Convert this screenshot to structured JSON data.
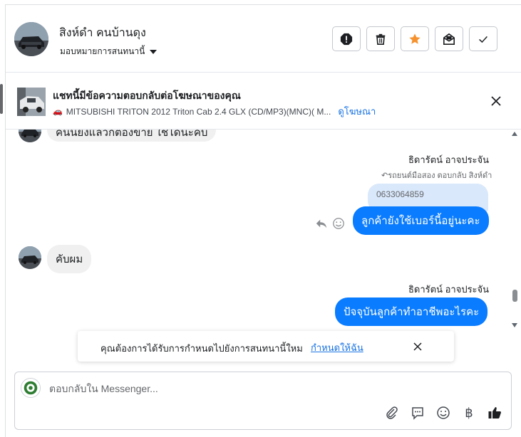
{
  "header": {
    "name": "สิงห์ดำ คนบ้านดุง",
    "assign_label": "มอบหมายการสนทนานี้",
    "actions": [
      {
        "name": "spam-button",
        "icon": "alert-icon"
      },
      {
        "name": "delete-button",
        "icon": "trash-icon"
      },
      {
        "name": "star-button",
        "icon": "star-icon",
        "color": "#f5922f"
      },
      {
        "name": "mark-unread-button",
        "icon": "envelope-icon"
      },
      {
        "name": "mark-done-button",
        "icon": "check-icon"
      }
    ]
  },
  "ad": {
    "title": "แชทนี้มีข้อความตอบกลับต่อโฆษณาของคุณ",
    "description": "MITSUBISHI TRITON 2012 Triton Cab 2.4 GLX (CD/MP3)(MNC)( M...",
    "link": "ดูโฆษณา"
  },
  "messages": {
    "partial_in": "คันนี้ยังแล้วก็ต้องขาย ใช้ได้นะคับ",
    "sender1": "ธิดารัตน์ อาจประจัน",
    "replied_to": "↶รถยนต์มือสอง ตอบกลับ สิงห์ดำ",
    "quote": "0633064859",
    "out1": "ลูกค้ายังใช้เบอร์นี้อยู่นะคะ",
    "in1": "คับผม",
    "sender2": "ธิดารัตน์ อาจประจัน",
    "out2": "ปัจจุบันลูกค้าทำอาชีพอะไรคะ"
  },
  "toast": {
    "text": "คุณต้องการได้รับการกำหนดไปยังการสนทนานี้ใหม",
    "link": "กำหนดให้ฉัน"
  },
  "composer": {
    "placeholder": "ตอบกลับใน Messenger...",
    "tools": [
      "attach-icon",
      "comment-icon",
      "emoji-icon",
      "baht-icon",
      "thumbs-up-icon"
    ],
    "baht_symbol": "฿"
  },
  "colors": {
    "accent": "#0a7cff",
    "link": "#1b74e4",
    "star": "#f5922f"
  }
}
